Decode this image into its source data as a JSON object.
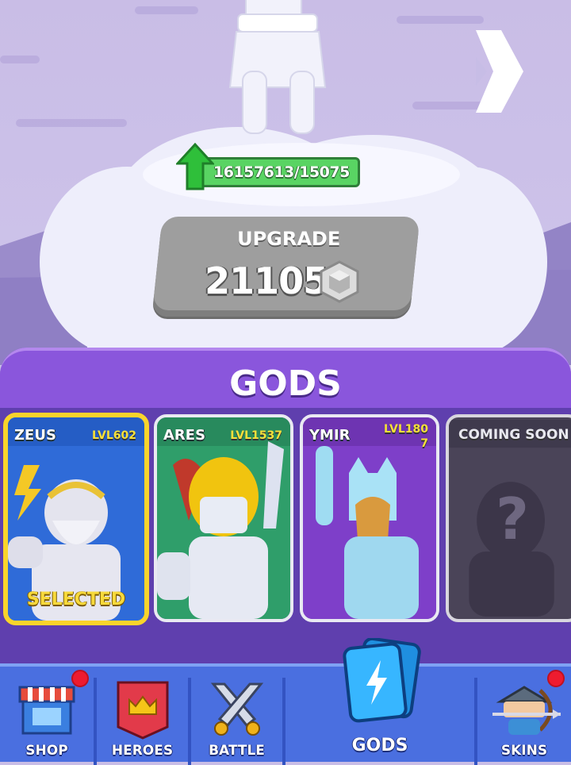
{
  "scene": {
    "power_text": "16157613/15075",
    "upgrade": {
      "label": "UPGRADE",
      "cost": "21105"
    }
  },
  "panel": {
    "title": "GODS",
    "cards": [
      {
        "name": "ZEUS",
        "level": "LVL602",
        "status": "SELECTED"
      },
      {
        "name": "ARES",
        "level": "LVL1537"
      },
      {
        "name": "YMIR",
        "level": "LVL180\n7"
      },
      {
        "name": "COMING SOON",
        "placeholder": "?"
      }
    ]
  },
  "nav": [
    {
      "label": "SHOP",
      "notification": true
    },
    {
      "label": "HEROES",
      "notification": false
    },
    {
      "label": "BATTLE",
      "notification": false
    },
    {
      "label": "GODS",
      "active": true
    },
    {
      "label": "SKINS",
      "notification": true
    }
  ],
  "colors": {
    "panel": "#5f3fae",
    "header": "#8a56dc",
    "navbar": "#4a6fe0",
    "selected_border": "#f9d42b",
    "notification": "#ee1b2f",
    "power_bar": "#59d463"
  }
}
